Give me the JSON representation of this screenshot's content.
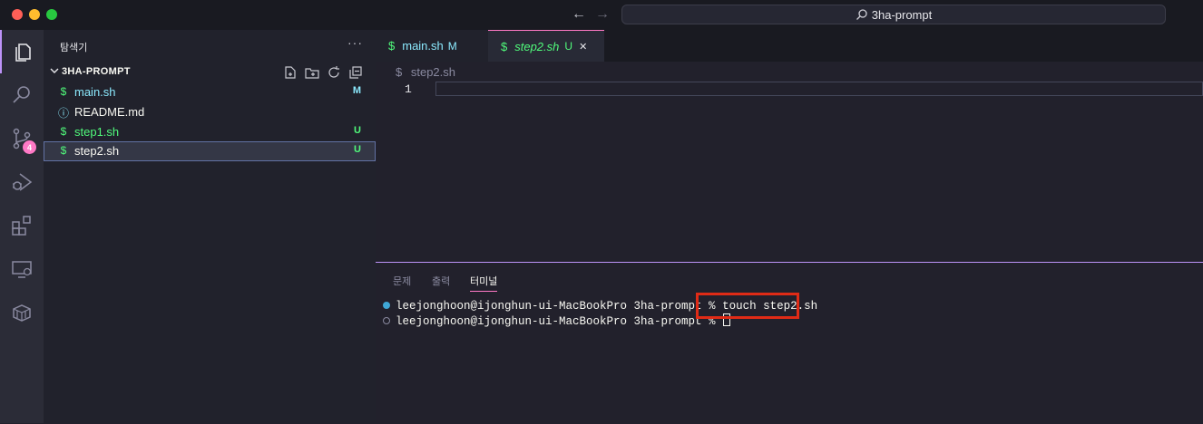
{
  "window": {
    "search_text": "3ha-prompt",
    "back_arrow": "←",
    "forward_arrow": "→"
  },
  "activity_bar": {
    "items": [
      {
        "name": "explorer",
        "icon": "files-icon"
      },
      {
        "name": "search",
        "icon": "search-icon"
      },
      {
        "name": "source-control",
        "icon": "source-control-icon",
        "badge": "4"
      },
      {
        "name": "run-debug",
        "icon": "run-debug-icon"
      },
      {
        "name": "extensions",
        "icon": "extensions-icon"
      },
      {
        "name": "remote-explorer",
        "icon": "remote-explorer-icon"
      },
      {
        "name": "packages",
        "icon": "box-icon"
      }
    ]
  },
  "sidebar": {
    "title": "탐색기",
    "more": "···",
    "folder_name": "3HA-PROMPT",
    "files": [
      {
        "icon": "$",
        "name": "main.sh",
        "status": "M",
        "name_color": "#8be9fd",
        "status_color": "#8be9fd",
        "icon_color": "#50fa7b"
      },
      {
        "icon": "ⓘ",
        "name": "README.md",
        "status": "",
        "name_color": "#f8f8f2",
        "status_color": "#f8f8f2",
        "icon_color": "#8be9fd"
      },
      {
        "icon": "$",
        "name": "step1.sh",
        "status": "U",
        "name_color": "#50fa7b",
        "status_color": "#50fa7b",
        "icon_color": "#50fa7b"
      },
      {
        "icon": "$",
        "name": "step2.sh",
        "status": "U",
        "name_color": "#f8f8f2",
        "status_color": "#50fa7b",
        "icon_color": "#50fa7b"
      }
    ]
  },
  "tabs": [
    {
      "icon": "$",
      "label": "main.sh",
      "status": "M"
    },
    {
      "icon": "$",
      "label": "step2.sh",
      "status": "U",
      "close": "✕"
    }
  ],
  "editor": {
    "breadcrumb_icon": "$",
    "breadcrumb": "step2.sh",
    "line_number": "1"
  },
  "panel": {
    "tabs": [
      "문제",
      "출력",
      "터미널"
    ],
    "active_tab": "터미널",
    "terminal": {
      "line1_prompt": "leejonghoon@ijonghun-ui-MacBookPro 3ha-prompt % ",
      "line1_command": "touch step2.sh",
      "line2_prompt": "leejonghoon@ijonghun-ui-MacBookPro 3ha-prompt % "
    }
  },
  "colors": {
    "accent_purple": "#bd93f9",
    "accent_pink": "#ff79c6",
    "highlight_red": "#e02b16"
  }
}
